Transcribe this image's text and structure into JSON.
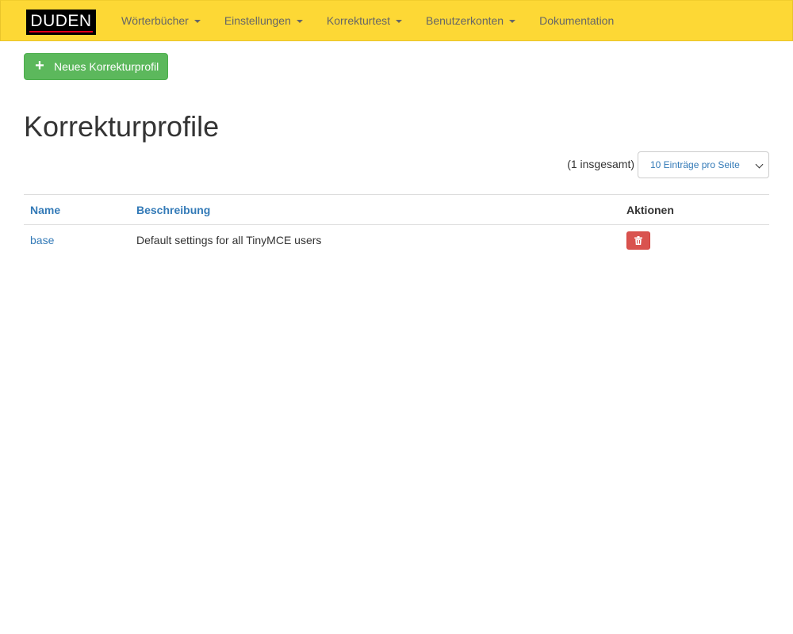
{
  "brand": {
    "logo_text": "DUDEN"
  },
  "nav": {
    "items": [
      {
        "label": "Wörterbücher",
        "dropdown": true
      },
      {
        "label": "Einstellungen",
        "dropdown": true
      },
      {
        "label": "Korrekturtest",
        "dropdown": true
      },
      {
        "label": "Benutzerkonten",
        "dropdown": true
      },
      {
        "label": "Dokumentation",
        "dropdown": false
      }
    ]
  },
  "toolbar": {
    "new_profile_label": "Neues Korrekturprofil",
    "new_icon": "plus-icon"
  },
  "page": {
    "title": "Korrekturprofile"
  },
  "pagination": {
    "total_text": "(1 insgesamt)",
    "per_page_selected": "10 Einträge pro Seite"
  },
  "table": {
    "headers": {
      "name": "Name",
      "description": "Beschreibung",
      "actions": "Aktionen"
    },
    "rows": [
      {
        "name": "base",
        "description": "Default settings for all TinyMCE users",
        "action_icon": "trash-icon"
      }
    ]
  },
  "colors": {
    "navbar": "#fdd835",
    "success": "#5cb85c",
    "danger": "#d9534f",
    "link": "#337ab7",
    "brand_red": "#e2001a"
  }
}
